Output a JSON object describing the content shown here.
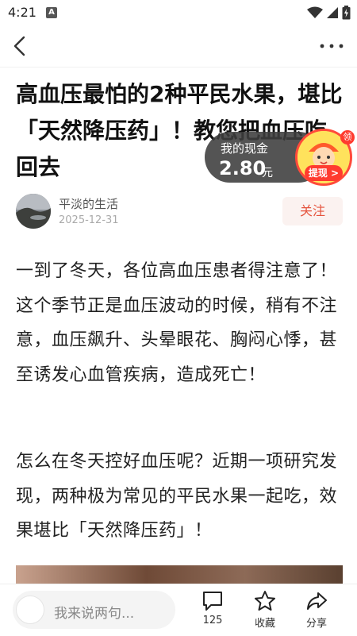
{
  "status_bar": {
    "time": "4:21",
    "notification_icon": "A"
  },
  "header": {
    "back_icon": "chevron-left-icon",
    "more_icon": "more-horizontal-icon"
  },
  "article": {
    "title": "高血压最怕的2种平民水果，堪比「天然降压药」！教您把血压吃回去",
    "author": "平淡的生活",
    "date": "2025-12-31",
    "follow_label": "关注",
    "paragraphs": [
      "一到了冬天，各位高血压患者得注意了！这个季节正是血压波动的时候，稍有不注意，血压飙升、头晕眼花、胸闷心悸，甚至诱发心血管疾病，造成死亡！",
      "怎么在冬天控好血压呢？近期一项研究发现，两种极为常见的平民水果一起吃，效果堪比「天然降压药」！"
    ]
  },
  "cash_widget": {
    "label": "我的现金",
    "amount": "2.80",
    "unit": "元",
    "withdraw_label": "提现 >",
    "badge": "领"
  },
  "bottom_bar": {
    "comment_placeholder": "我来说两句...",
    "comment_count": "125",
    "favorite_label": "收藏",
    "share_label": "分享"
  },
  "colors": {
    "accent": "#e5533d",
    "widget_bg": "#3c3c3c",
    "coin_yellow": "#ffe25c"
  }
}
